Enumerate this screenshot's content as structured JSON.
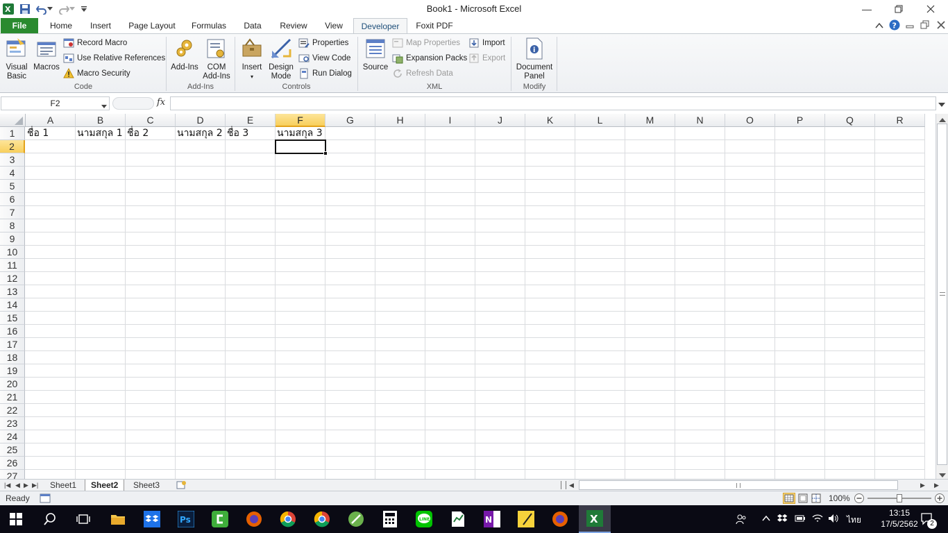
{
  "window": {
    "title": "Book1  -  Microsoft Excel"
  },
  "tabs": {
    "file": "File",
    "items": [
      "Home",
      "Insert",
      "Page Layout",
      "Formulas",
      "Data",
      "Review",
      "View",
      "Developer",
      "Foxit PDF"
    ],
    "active": "Developer"
  },
  "ribbon": {
    "code": {
      "label": "Code",
      "visual_basic": [
        "Visual",
        "Basic"
      ],
      "macros": "Macros",
      "record_macro": "Record Macro",
      "use_relative": "Use Relative References",
      "macro_security": "Macro Security"
    },
    "addins": {
      "label": "Add-Ins",
      "addins": "Add-Ins",
      "com_addins": [
        "COM",
        "Add-Ins"
      ]
    },
    "controls": {
      "label": "Controls",
      "insert": "Insert",
      "design_mode": [
        "Design",
        "Mode"
      ],
      "properties": "Properties",
      "view_code": "View Code",
      "run_dialog": "Run Dialog"
    },
    "xml": {
      "label": "XML",
      "source": "Source",
      "map_properties": "Map Properties",
      "expansion_packs": "Expansion Packs",
      "refresh_data": "Refresh Data",
      "import": "Import",
      "export": "Export"
    },
    "modify": {
      "label": "Modify",
      "document_panel": [
        "Document",
        "Panel"
      ]
    }
  },
  "formula_bar": {
    "name_box": "F2",
    "fx": "fx",
    "value": ""
  },
  "sheet": {
    "columns": [
      "A",
      "B",
      "C",
      "D",
      "E",
      "F",
      "G",
      "H",
      "I",
      "J",
      "K",
      "L",
      "M",
      "N",
      "O",
      "P",
      "Q",
      "R"
    ],
    "selected_column": "F",
    "rows": [
      "1",
      "2",
      "3",
      "4",
      "5",
      "6",
      "7",
      "8",
      "9",
      "10",
      "11",
      "12",
      "13",
      "14",
      "15",
      "16",
      "17",
      "18",
      "19",
      "20",
      "21",
      "22",
      "23",
      "24",
      "25",
      "26",
      "27"
    ],
    "selected_row": "2",
    "row1": [
      "ชื่อ 1",
      "นามสกุล 1",
      "ชื่อ 2",
      "นามสกุล 2",
      "ชื่อ 3",
      "นามสกุล 3"
    ],
    "active_cell": "F2"
  },
  "sheet_tabs": [
    "Sheet1",
    "Sheet2",
    "Sheet3"
  ],
  "active_sheet": "Sheet2",
  "status": {
    "ready": "Ready",
    "zoom": "100%"
  },
  "taskbar": {
    "time": "13:15",
    "date": "17/5/2562",
    "lang": "ไทย",
    "notifications": "2"
  },
  "colors": {
    "file_tab": "#2a8a2f",
    "selection_header": "#f8cf5c",
    "taskbar": "#0a0a14"
  }
}
